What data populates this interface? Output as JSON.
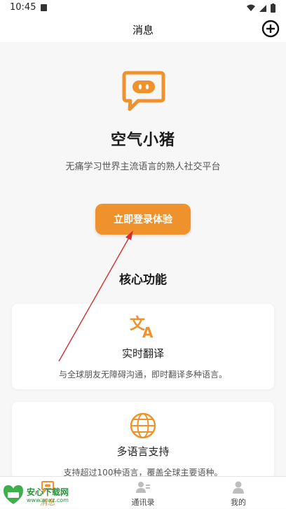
{
  "status_bar": {
    "time": "10:45"
  },
  "app_bar": {
    "title": "消息"
  },
  "hero": {
    "app_name": "空气小猪",
    "tagline": "无痛学习世界主流语言的熟人社交平台",
    "login_button": "立即登录体验"
  },
  "features": {
    "section_title": "核心功能",
    "items": [
      {
        "title": "实时翻译",
        "desc": "与全球朋友无障碍沟通，即时翻译多种语言。",
        "icon": "translate-icon"
      },
      {
        "title": "多语言支持",
        "desc": "支持超过100种语言，覆盖全球主要语种。",
        "icon": "globe-icon"
      }
    ]
  },
  "bottom_nav": {
    "items": [
      {
        "label": "消息",
        "icon": "chat-icon"
      },
      {
        "label": "通讯录",
        "icon": "contacts-icon"
      },
      {
        "label": "我的",
        "icon": "person-icon"
      }
    ]
  },
  "watermark": {
    "text": "安心下载网",
    "url": "www.anxz.com"
  },
  "colors": {
    "accent": "#f0922b",
    "background": "#f7f7f8",
    "annotation": "#d32f2f"
  }
}
